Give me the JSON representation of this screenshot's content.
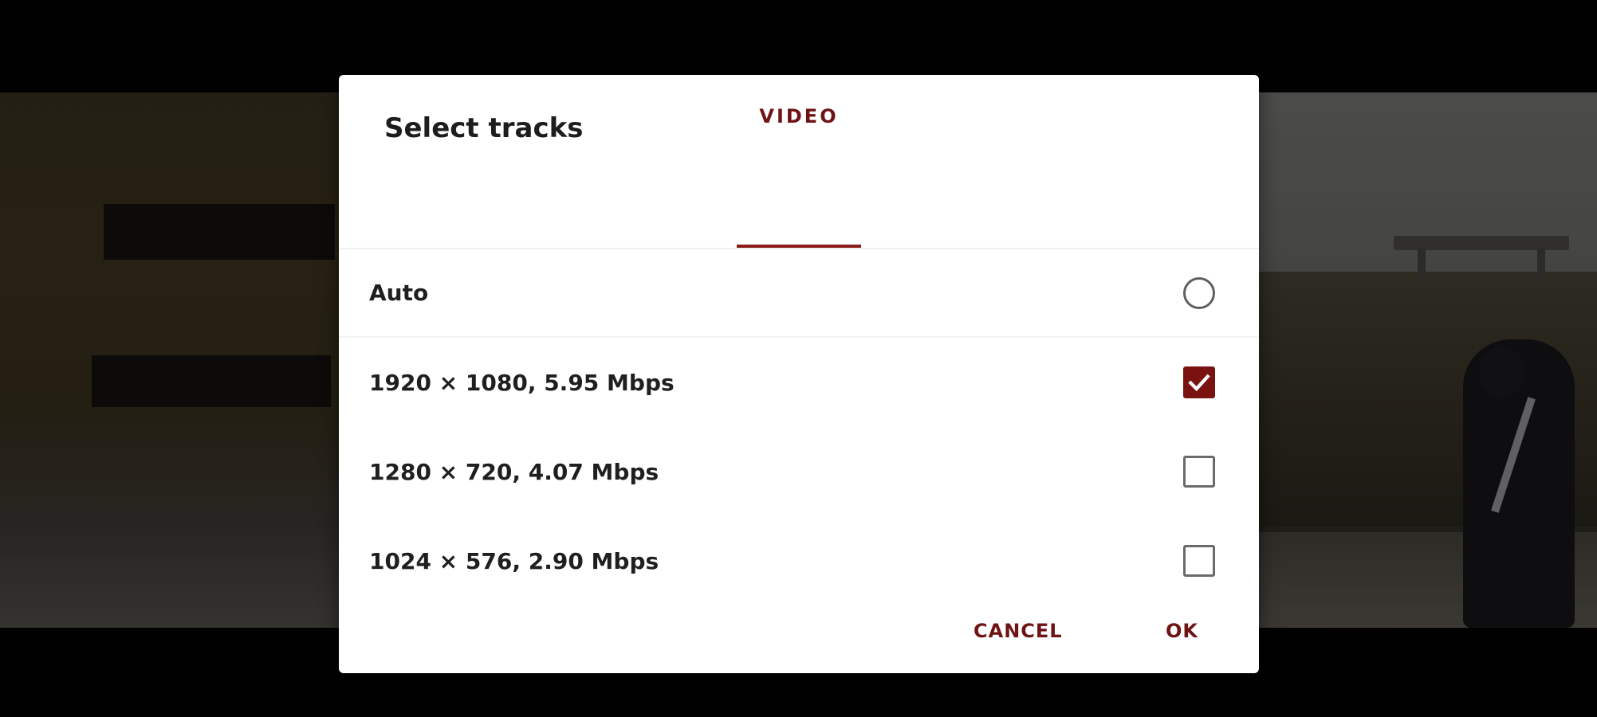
{
  "dialog": {
    "title": "Select tracks",
    "tabs": [
      {
        "label": "VIDEO",
        "selected": true
      }
    ],
    "tracks": [
      {
        "label": "Auto",
        "control": "radio",
        "checked": false
      },
      {
        "label": "1920 × 1080, 5.95 Mbps",
        "control": "checkbox",
        "checked": true
      },
      {
        "label": "1280 × 720, 4.07 Mbps",
        "control": "checkbox",
        "checked": false
      },
      {
        "label": "1024 × 576, 2.90 Mbps",
        "control": "checkbox",
        "checked": false
      }
    ],
    "buttons": {
      "cancel": "CANCEL",
      "ok": "OK"
    }
  },
  "colors": {
    "accent": "#7a1212",
    "dialog_bg": "#ffffff",
    "backdrop": "#000000"
  },
  "icons": [
    "radio-icon",
    "checkbox-checked-icon",
    "checkbox-empty-icon",
    "checkmark-icon"
  ]
}
